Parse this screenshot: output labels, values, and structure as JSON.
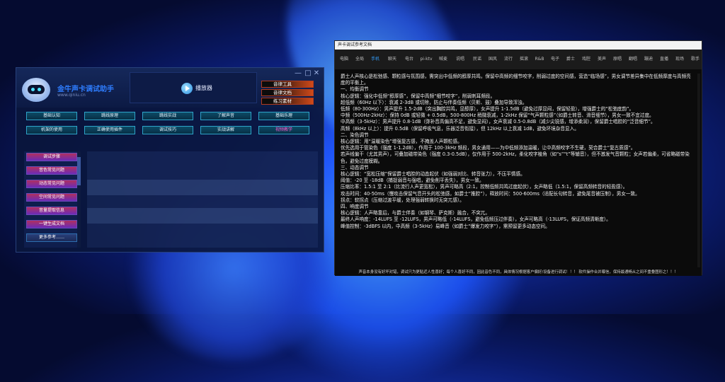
{
  "app": {
    "brand": "金牛声卡调试助手",
    "url": "www.qiniu.cn",
    "window_controls": [
      "—",
      "□",
      "✕"
    ],
    "player_label": "播放器",
    "tools": [
      "音律工具",
      "音律文档",
      "练习素材"
    ],
    "nav_rows": [
      [
        "基础认知",
        "跳线原理",
        "跳线实战",
        "了解声音",
        "基础乐理"
      ],
      [
        "机架的使用",
        "正确使用插件",
        "调试技巧",
        "实战讲解",
        "视频教学"
      ]
    ],
    "nav_active": "视频教学",
    "side_items": [
      "调试步骤",
      "音色常见问题",
      "动态常见问题",
      "空间常见问题",
      "音量提取信息",
      "一键生成文档",
      "更多参考……"
    ],
    "accent_pink": "#ff5ad1"
  },
  "doc": {
    "title": "声卡调试参考文档",
    "tabs": [
      "电脑",
      "全局",
      "手机",
      "聊天",
      "电台",
      "pi-ktv",
      "喊麦",
      "说唱",
      "民谣",
      "国风",
      "流行",
      "摇滚",
      "R&B",
      "电子",
      "爵士",
      "戏腔",
      "美声",
      "原唱",
      "翻唱",
      "蹦迪",
      "直播",
      "现场",
      "歌手",
      "金曲",
      "配唱",
      "精品",
      "主播"
    ],
    "active_tab": "手机",
    "lines": [
      "爵士人声核心是松弛感、颗粒感与氛围感，需突出中低频的醇厚共鸣，保留中高频的细节咬字，削弱过度的空间感，营造“临场感”，男女调节差异集中在低频厚度与高频亮度的平衡上。",
      "一、均衡调节",
      "核心逻辑：强化中低频“醇厚感”，保留中高频“细节咬字”，削弱刺耳频段。",
      "超低频（60Hz 以下）：衰减 2-3dB 或切除，防止与伴奏低频（贝斯、鼓）叠加导致浑浊。",
      "低频（80-300Hz）：男声提升 1.5-2dB（突出胸腔共鸣，显醇厚），女声提升 1-1.5dB（避免过厚显闷，保留轻盈），增强爵士的“松弛底韵”。",
      "中频（500Hz-2kHz）：保持 0dB 或轻微 + 0.5dB，500-800Hz 稍微衰减，1-2kHz 保留“气声颗粒感”（如爵士转音、滑音细节），男女一致不宜过度。",
      "中高频（3-5kHz）：男声提升 0.8-1dB（弥补音高偏高不足，避免显闷），女声衰减 0.5-0.8dB（减少尖锐感，增添柔润），保留爵士唱腔的“泛音细节”。",
      "高频（8kHz 以上）：提升 0.5dB（保留呼吸气息，乐器泛音衔接），但 12kHz 以上衰减 1dB，避免环境杂音显入。",
      "二、染色调节",
      "核心逻辑：用“温暖染色”增强复古感，不掩盖人声颗粒感。",
      "优先选用于管染色（强度 1-1.2dB），作用于 100-3kHz 频段，男女通用——为中低频添加温暖，让中高频咬字不生硬，契合爵士“复古质感”。",
      "若声线偏干（尤其男声），可叠加磁带染色（强度 0.3-0.5dB），仅作用于 500-2kHz，柔化咬字棱角（如“s”“t”等辅音），但不激发气音颗粒；女声若偏柔，可省略磁带染色，避免过度模糊。",
      "三、动态调节",
      "核心逻辑：“宽松压缩”保留爵士唱腔的动态起伏（如强弱对比、转音张力），不压平情感。",
      "阈值：-20 至 -18dB（捕捉弱音与强唱，避免削平丢失），男女一致。",
      "压缩比率：1.5:1 至 2:1（比流行人声更宽松），男声可略高（2:1，控制低频共鸣过度起伏），女声略低（1.5:1，保留高频转音的轻盈感）。",
      "攻击时间：40-50ms（慢攻击保留气音开头的松弛感，如爵士“推腔”），释放时间：500-600ms（适配长句转音，避免尾音被压制），男女一致。",
      "拐点：软拐点（压缩过渡平缓，处理强弱转换时无突兀感）。",
      "四、响度调节",
      "核心逻辑：人声略靠后，与爵士伴奏（如钢琴、萨克斯）融合，不突兀。",
      "最终人声响度：-14LUFS 至 -12LUFS，男声可略低（-14LUFS，避免低频压过伴奏），女声可略高（-13LUFS，保证高频清晰度）。",
      "峰值控制：-3dBFS 以内，中高频（3-5kHz）易峰音（如爵士“爆发力咬字”），需预留更多动态空间。"
    ],
    "footer": "声音本身没有好坏对错，调试只为更贴近人性喜好；每个人喜好不同，因此音色不同，具体情况根据客户偏好/设备进行调试！！！ 软件操作合并曝信，保持最通畅从之间不重叠图形之！！！"
  }
}
